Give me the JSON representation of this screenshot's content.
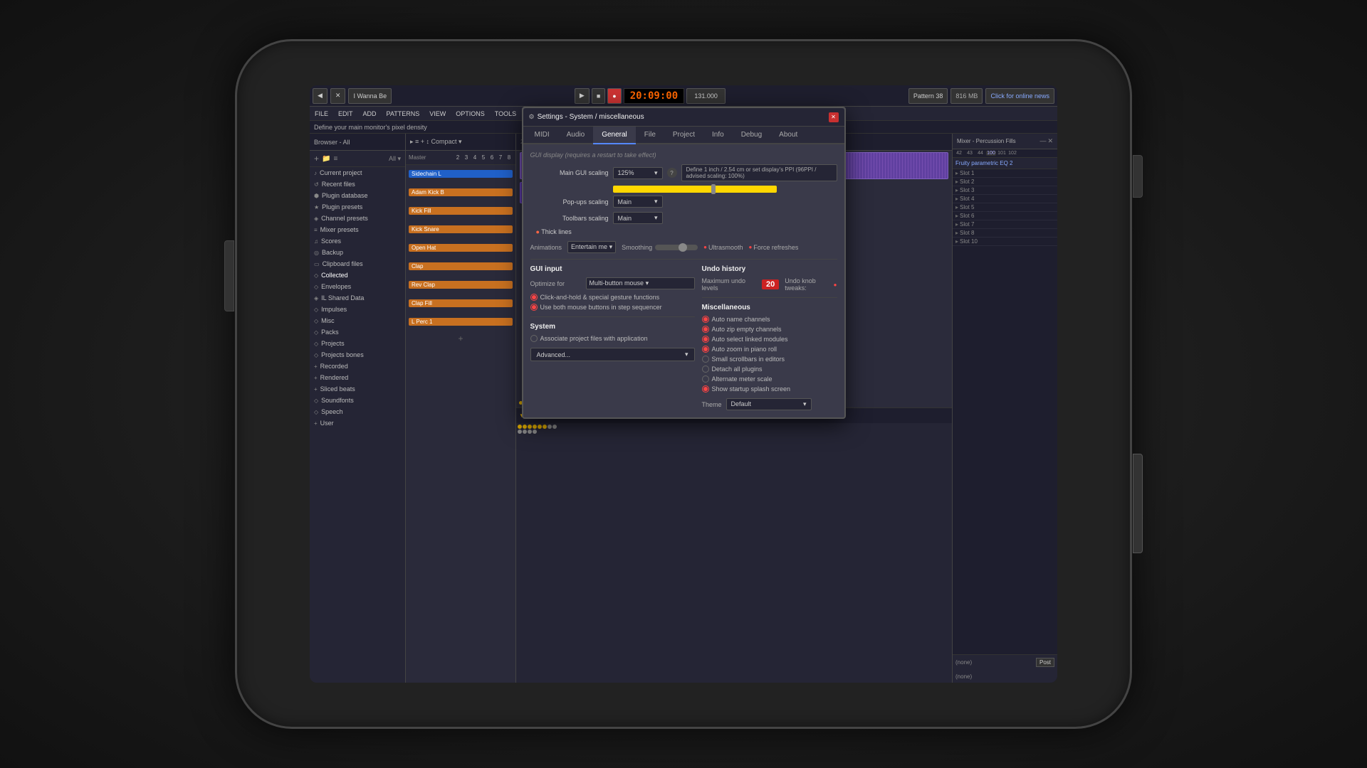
{
  "phone": {
    "background": "#1a1a1a"
  },
  "daw": {
    "title": "I Wanna Be",
    "time_display": "20:09:00",
    "bpm": "131.000",
    "pattern": "Pattern 38",
    "memory": "816 MB",
    "status_hint": "Define your main monitor's pixel density",
    "online_news": "Click for online news"
  },
  "menu": {
    "items": [
      "FILE",
      "EDIT",
      "ADD",
      "PATTERNS",
      "VIEW",
      "OPTIONS",
      "TOOLS",
      "?"
    ]
  },
  "sidebar": {
    "header": "Browser - All",
    "items": [
      {
        "label": "Current project",
        "icon": "♪"
      },
      {
        "label": "Recent files",
        "icon": "↺"
      },
      {
        "label": "Plugin database",
        "icon": "⬢"
      },
      {
        "label": "Plugin presets",
        "icon": "★"
      },
      {
        "label": "Channel presets",
        "icon": "◈"
      },
      {
        "label": "Mixer presets",
        "icon": "≡"
      },
      {
        "label": "Scores",
        "icon": "♫"
      },
      {
        "label": "Backup",
        "icon": "◎"
      },
      {
        "label": "Clipboard files",
        "icon": "📋"
      },
      {
        "label": "Collected",
        "icon": "◇"
      },
      {
        "label": "Envelopes",
        "icon": "◇"
      },
      {
        "label": "IL Shared Data",
        "icon": "◈"
      },
      {
        "label": "Impulses",
        "icon": "◇"
      },
      {
        "label": "Misc",
        "icon": "◇"
      },
      {
        "label": "Packs",
        "icon": "◇"
      },
      {
        "label": "Projects",
        "icon": "◇"
      },
      {
        "label": "Projects bones",
        "icon": "◇"
      },
      {
        "label": "Recorded",
        "icon": "+"
      },
      {
        "label": "Rendered",
        "icon": "+"
      },
      {
        "label": "Sliced beats",
        "icon": "+"
      },
      {
        "label": "Soundfonts",
        "icon": "◇"
      },
      {
        "label": "Speech",
        "icon": "◇"
      },
      {
        "label": "User",
        "icon": "+"
      }
    ]
  },
  "channels": [
    {
      "name": "Sidechain L",
      "color": "blue"
    },
    {
      "name": "Adam Kick B",
      "color": "orange"
    },
    {
      "name": "Kick Fill",
      "color": "orange"
    },
    {
      "name": "Kick Snare",
      "color": "orange"
    },
    {
      "name": "Open Hat",
      "color": "orange"
    },
    {
      "name": "Clap",
      "color": "orange"
    },
    {
      "name": "Rev Clap",
      "color": "orange"
    },
    {
      "name": "Clap Fill",
      "color": "orange"
    },
    {
      "name": "L Perc 1",
      "color": "orange"
    }
  ],
  "settings_dialog": {
    "title": "Settings - System / miscellaneous",
    "tabs": [
      "MIDI",
      "Audio",
      "General",
      "File",
      "Project",
      "Info",
      "Debug",
      "About"
    ],
    "active_tab": "General",
    "gui_display": {
      "section_label": "GUI display (requires a restart to take effect)",
      "main_gui_scaling_label": "Main GUI scaling",
      "main_gui_scaling_value": "125%",
      "help_icon": "?",
      "scaling_hint": "Define 1 inch / 2.54 cm or set display's PPI (96PPI / advised scaling: 100%)",
      "popups_scaling_label": "Pop-ups scaling",
      "popups_scaling_value": "Main",
      "toolbars_scaling_label": "Toolbars scaling",
      "toolbars_scaling_value": "Main",
      "thick_lines_label": "Thick lines",
      "animations_label": "Animations",
      "animations_value": "Entertain me",
      "smoothing_label": "Smoothing",
      "ultrasmooth_label": "Ultrasmooth",
      "force_refreshes_label": "Force refreshes"
    },
    "gui_input": {
      "title": "GUI input",
      "optimize_label": "Optimize for",
      "optimize_value": "Multi-button mouse",
      "option1": "Click-and-hold & special gesture functions",
      "option2": "Use both mouse buttons in step sequencer"
    },
    "undo_history": {
      "title": "Undo history",
      "max_undo_label": "Maximum undo levels",
      "max_undo_value": "20",
      "undo_knob_label": "Undo knob tweaks:"
    },
    "miscellaneous": {
      "title": "Miscellaneous",
      "options": [
        "Auto name channels",
        "Auto zip empty channels",
        "Auto select linked modules",
        "Auto zoom in piano roll",
        "Small scrollbars in editors",
        "Detach all plugins",
        "Alternate meter scale",
        "Show startup splash screen"
      ]
    },
    "system": {
      "title": "System",
      "option1": "Associate project files with application"
    },
    "theme": {
      "label": "Theme",
      "value": "Default"
    },
    "advanced_btn": "Advanced..."
  },
  "mixer": {
    "title": "Mixer - Percussion Fills",
    "plugin": "Fruity parametric EQ 2",
    "slots": [
      "(none)",
      "Slot 1",
      "Slot 2",
      "Slot 3",
      "Slot 4",
      "Slot 5",
      "Slot 6",
      "Slot 7",
      "Slot 8",
      "Slot 10"
    ],
    "insert_label": "(none)",
    "post_label": "Post",
    "none_label": "(none)"
  }
}
